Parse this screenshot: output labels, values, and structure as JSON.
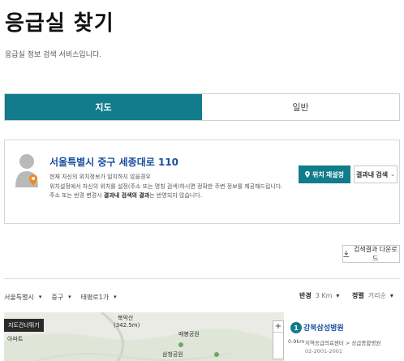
{
  "header": {
    "title": "응급실 찾기",
    "description": "응급실 정보 검색 서비스입니다."
  },
  "tabs": [
    {
      "label": "지도",
      "active": true
    },
    {
      "label": "일반",
      "active": false
    }
  ],
  "location": {
    "address": "서울특별시 중구 세종대로 110",
    "notice_line1": "현재 자신의 위치정보가 일치하지 않을경우",
    "notice_line2": "위치설정에서 자신의 위치를 설정(주소 또는 명칭 검색)하시면 정확한 주변 정보를 제공해드립니다.",
    "notice_line3_pre": "주소 또는 반경 변경시 ",
    "notice_line3_bold": "결과내 검색의 결과",
    "notice_line3_post": "는 반영되지 않습니다.",
    "reset_button": "위치 재설정",
    "filter_button": "결과내 검색"
  },
  "download_button": "검색결과 다운로드",
  "filters": {
    "city": "서울특별시",
    "district": "중구",
    "street": "태평로1가",
    "radius_label": "반경",
    "radius_value": "3 Km",
    "sort_label": "정렬",
    "sort_value": "거리순"
  },
  "map": {
    "toggle_label": "지도건너뛰기",
    "labels": {
      "peak": "북악산",
      "elevation": "(342.5m)",
      "park": "삼청공원",
      "apartment": "아파트",
      "station": "매봉공원"
    }
  },
  "results": [
    {
      "number": "1",
      "name": "강북삼성병원",
      "distance": "0.9km",
      "type": "지역응급의료센터 > 상급종합병원",
      "phone": "02-2001-2001"
    }
  ],
  "colors": {
    "accent": "#127c8c",
    "link": "#1a4fa0",
    "pin": "#f08a24"
  }
}
